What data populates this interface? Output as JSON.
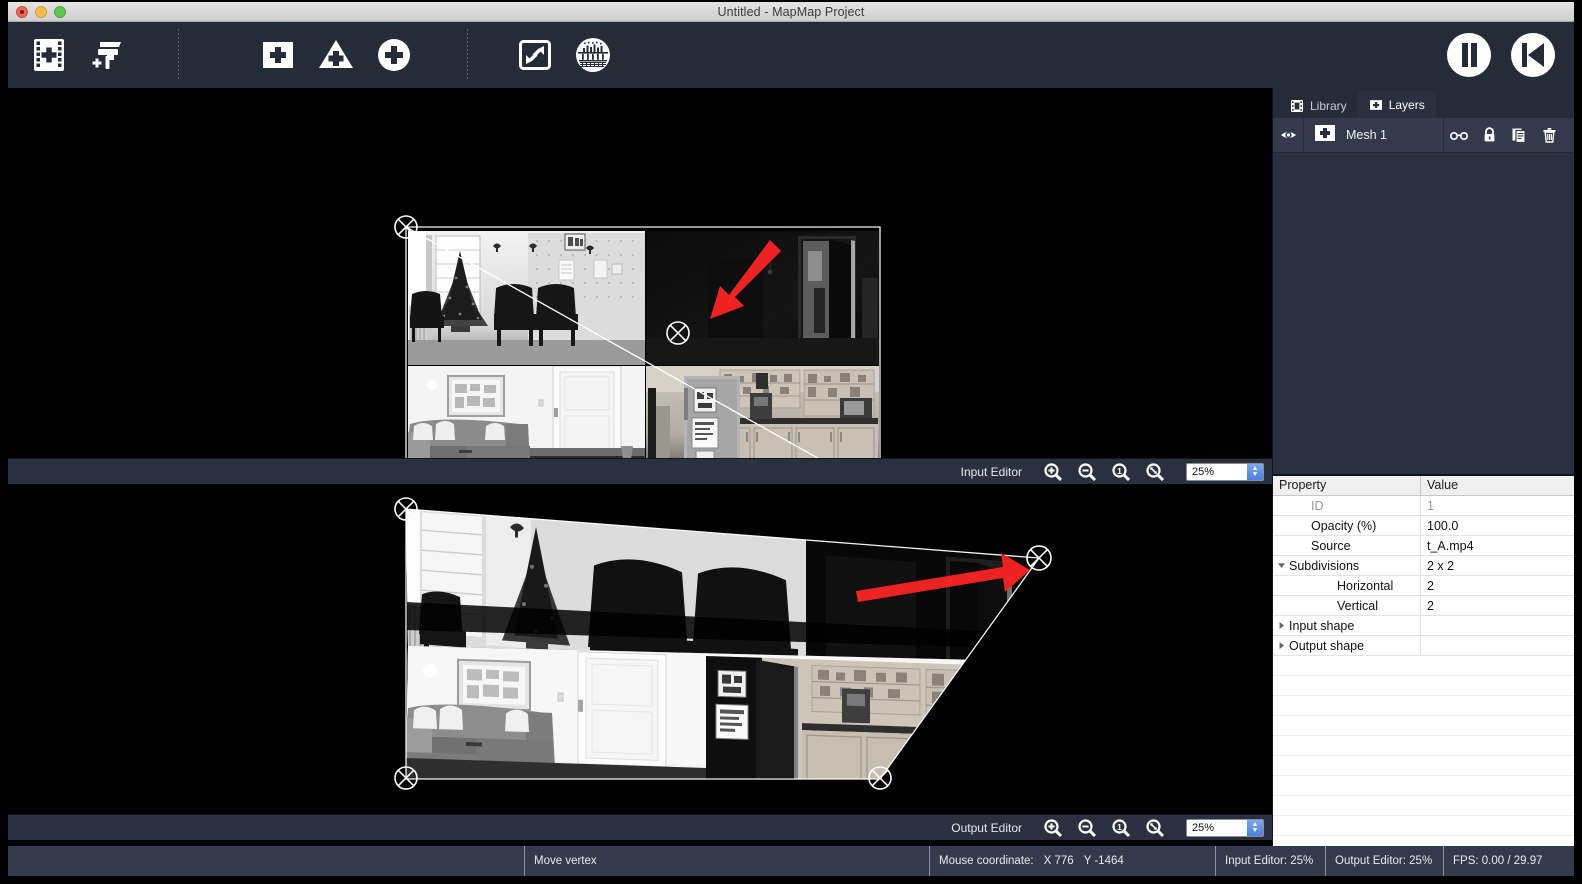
{
  "window": {
    "title": "Untitled - MapMap Project",
    "traffic_lights": [
      "close",
      "minimize",
      "maximize"
    ]
  },
  "toolbar": {
    "groups": [
      {
        "name": "media",
        "buttons": [
          {
            "id": "add-media",
            "icon": "film-plus-icon",
            "label": "Add Media"
          },
          {
            "id": "add-color",
            "icon": "paint-roller-plus-icon",
            "label": "Add Color"
          }
        ]
      },
      {
        "name": "shapes",
        "buttons": [
          {
            "id": "add-mesh",
            "icon": "square-plus-icon",
            "label": "Add Mesh"
          },
          {
            "id": "add-triangle",
            "icon": "triangle-plus-icon",
            "label": "Add Triangle"
          },
          {
            "id": "add-ellipse",
            "icon": "circle-plus-icon",
            "label": "Add Ellipse"
          }
        ]
      },
      {
        "name": "display",
        "buttons": [
          {
            "id": "fullscreen",
            "icon": "fullscreen-icon",
            "label": "Fullscreen"
          },
          {
            "id": "test-signal",
            "icon": "test-pattern-icon",
            "label": "Display Test Signal"
          }
        ]
      }
    ],
    "transport": [
      {
        "id": "pause",
        "icon": "pause-icon",
        "label": "Pause"
      },
      {
        "id": "rewind",
        "icon": "rewind-icon",
        "label": "Rewind"
      }
    ]
  },
  "input_editor": {
    "label": "Input Editor",
    "zoom_value": "25%",
    "zoom_buttons": [
      {
        "id": "zoom-in",
        "icon": "zoom-in-icon"
      },
      {
        "id": "zoom-out",
        "icon": "zoom-out-icon"
      },
      {
        "id": "zoom-reset",
        "icon": "zoom-one-to-one-icon"
      },
      {
        "id": "zoom-fit",
        "icon": "zoom-fit-icon"
      }
    ]
  },
  "output_editor": {
    "label": "Output Editor",
    "zoom_value": "25%",
    "zoom_buttons": [
      {
        "id": "zoom-in",
        "icon": "zoom-in-icon"
      },
      {
        "id": "zoom-out",
        "icon": "zoom-out-icon"
      },
      {
        "id": "zoom-reset",
        "icon": "zoom-one-to-one-icon"
      },
      {
        "id": "zoom-fit",
        "icon": "zoom-fit-icon"
      }
    ]
  },
  "panel": {
    "tabs": [
      {
        "id": "library",
        "label": "Library",
        "icon": "film-icon",
        "active": false
      },
      {
        "id": "layers",
        "label": "Layers",
        "icon": "square-plus-icon",
        "active": true
      }
    ],
    "layers": [
      {
        "name": "Mesh 1",
        "visible": true,
        "icon": "square-plus-icon",
        "tools": [
          {
            "id": "solo",
            "icon": "glasses-icon"
          },
          {
            "id": "lock",
            "icon": "lock-icon"
          },
          {
            "id": "duplicate",
            "icon": "duplicate-icon"
          },
          {
            "id": "delete",
            "icon": "trash-icon"
          }
        ]
      }
    ],
    "properties": {
      "headers": [
        "Property",
        "Value"
      ],
      "rows": [
        {
          "key": "ID",
          "value": "1",
          "indent": 1,
          "disabled": true,
          "expander": "none"
        },
        {
          "key": "Opacity (%)",
          "value": "100.0",
          "indent": 1,
          "disabled": false,
          "expander": "none"
        },
        {
          "key": "Source",
          "value": "t_A.mp4",
          "indent": 1,
          "disabled": false,
          "expander": "none"
        },
        {
          "key": "Subdivisions",
          "value": "2 x 2",
          "indent": 0,
          "disabled": false,
          "expander": "open"
        },
        {
          "key": "Horizontal",
          "value": "2",
          "indent": 2,
          "disabled": false,
          "expander": "none"
        },
        {
          "key": "Vertical",
          "value": "2",
          "indent": 2,
          "disabled": false,
          "expander": "none"
        },
        {
          "key": "Input shape",
          "value": "",
          "indent": 0,
          "disabled": false,
          "expander": "closed"
        },
        {
          "key": "Output shape",
          "value": "",
          "indent": 0,
          "disabled": false,
          "expander": "closed"
        }
      ]
    }
  },
  "statusbar": {
    "action": "Move vertex",
    "mouse_label": "Mouse coordinate:",
    "mouse_x": "X 776",
    "mouse_y": "Y -1464",
    "input_zoom": "Input Editor: 25%",
    "output_zoom": "Output Editor: 25%",
    "fps": "FPS: 0.00 / 29.97"
  },
  "colors": {
    "toolbar_bg": "#262b38",
    "panel_bg": "#2b3040",
    "layer_row_bg": "#343a4b",
    "status_bg": "#343a4b",
    "canvas_bg": "#000000",
    "annotation_red": "#ee2222",
    "mesh_white": "#ffffff",
    "stepper_blue": "#4b7fe0"
  },
  "annotations": [
    {
      "id": "input-arrow",
      "color": "#ee2222",
      "direction": "down-left",
      "target": "center-vertex"
    },
    {
      "id": "output-arrow",
      "color": "#ee2222",
      "direction": "right",
      "target": "top-right-vertex"
    }
  ]
}
